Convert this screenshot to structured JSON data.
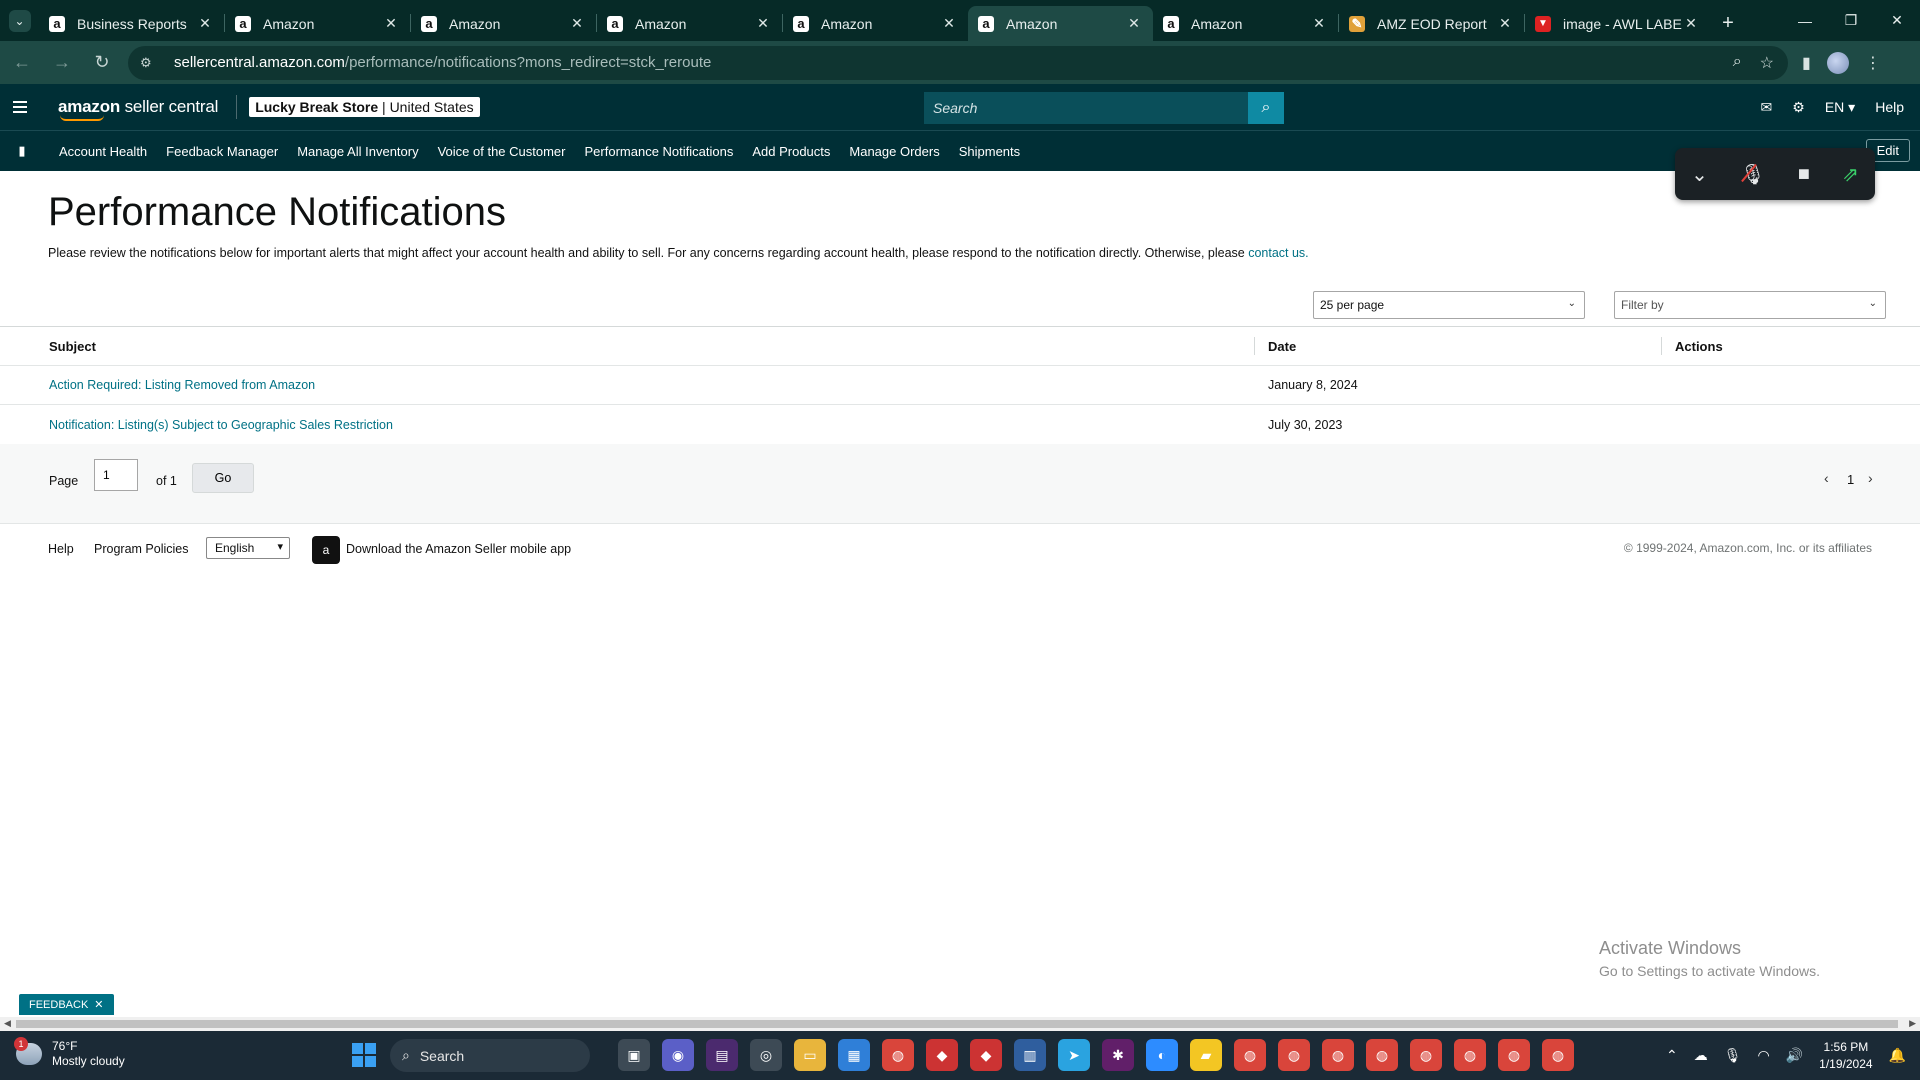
{
  "browser": {
    "tabs": [
      {
        "label": "Business Reports",
        "favicon": "a"
      },
      {
        "label": "Amazon",
        "favicon": "a"
      },
      {
        "label": "Amazon",
        "favicon": "a"
      },
      {
        "label": "Amazon",
        "favicon": "a"
      },
      {
        "label": "Amazon",
        "favicon": "a"
      },
      {
        "label": "Amazon",
        "favicon": "a",
        "active": true
      },
      {
        "label": "Amazon",
        "favicon": "a"
      },
      {
        "label": "AMZ EOD Report",
        "favicon": "amz-eod"
      },
      {
        "label": "image - AWL LABEL",
        "favicon": "awl"
      }
    ],
    "url_host": "sellercentral.amazon.com",
    "url_path": "/performance/notifications?mons_redirect=stck_reroute"
  },
  "header": {
    "logo_bold": "amazon",
    "logo_rest": " seller central",
    "store_name": "Lucky Break Store",
    "store_region": " | United States",
    "search_placeholder": "Search",
    "language": "EN",
    "help": "Help"
  },
  "nav": {
    "items": [
      "Account Health",
      "Feedback Manager",
      "Manage All Inventory",
      "Voice of the Customer",
      "Performance Notifications",
      "Add Products",
      "Manage Orders",
      "Shipments"
    ],
    "edit": "Edit"
  },
  "page": {
    "title": "Performance Notifications",
    "description": "Please review the notifications below for important alerts that might affect your account health and ability to sell. For any concerns regarding account health, please respond to the notification directly. Otherwise, please ",
    "contact_link": "contact us.",
    "per_page": "25 per page",
    "filter_placeholder": "Filter by"
  },
  "table": {
    "headers": {
      "subject": "Subject",
      "date": "Date",
      "actions": "Actions"
    },
    "rows": [
      {
        "subject": "Action Required: Listing Removed from Amazon",
        "date": "January 8, 2024"
      },
      {
        "subject": "Notification: Listing(s) Subject to Geographic Sales Restriction",
        "date": "July 30, 2023"
      }
    ]
  },
  "pager": {
    "page_label": "Page",
    "page_value": "1",
    "of_label": "of 1",
    "go": "Go",
    "current": "1"
  },
  "footer": {
    "help": "Help",
    "program_policies": "Program Policies",
    "language": "English",
    "app_download": "Download the Amazon Seller mobile app",
    "copyright": "© 1999-2024, Amazon.com, Inc. or its affiliates"
  },
  "watermark": {
    "line1": "Activate Windows",
    "line2": "Go to Settings to activate Windows."
  },
  "feedback": "FEEDBACK",
  "taskbar": {
    "weather_badge": "1",
    "temperature": "76°F",
    "condition": "Mostly cloudy",
    "search": "Search",
    "time": "1:56 PM",
    "date": "1/19/2024"
  },
  "colors": {
    "seller_header": "#002f36",
    "link": "#007185",
    "browser_frame": "#1e4a45"
  }
}
